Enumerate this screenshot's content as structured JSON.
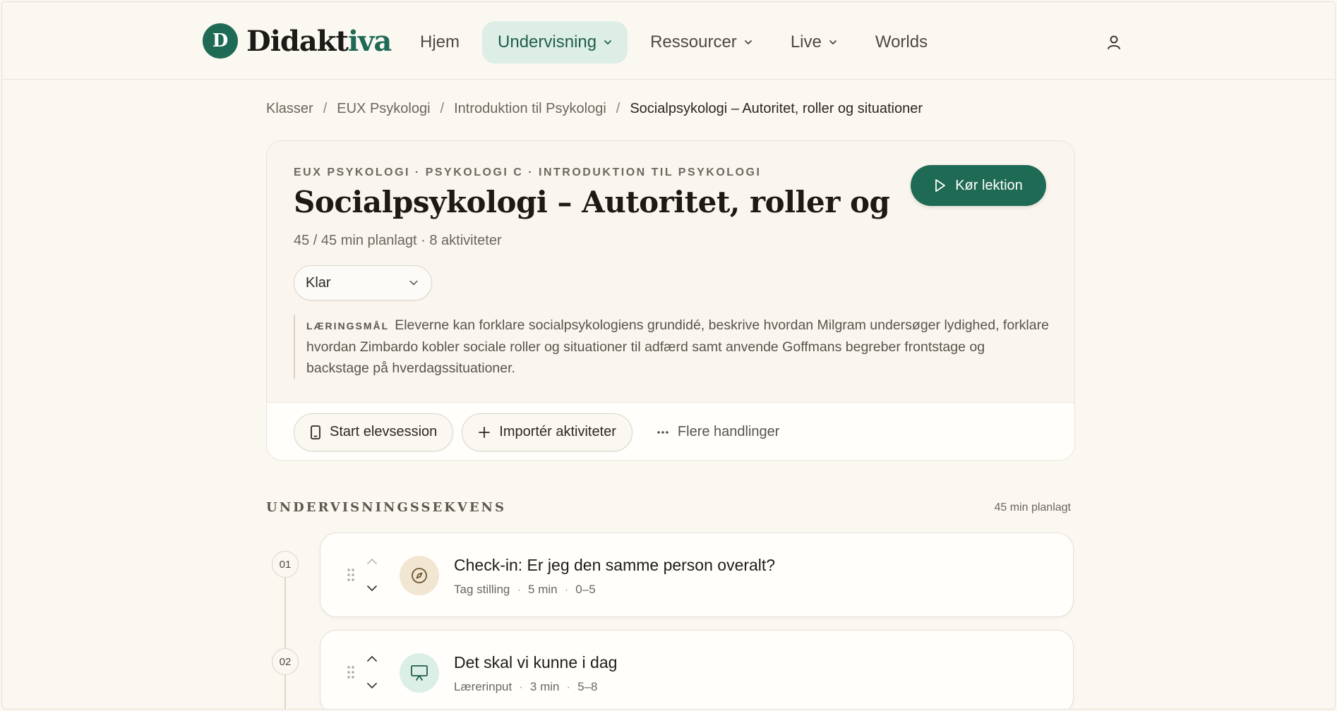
{
  "brand": {
    "letter": "D",
    "name_main": "Didakt",
    "name_accent": "iva",
    "accent_color": "#1f6a55"
  },
  "nav": {
    "items": [
      {
        "label": "Hjem",
        "dropdown": false
      },
      {
        "label": "Undervisning",
        "dropdown": true,
        "active": true
      },
      {
        "label": "Ressourcer",
        "dropdown": true
      },
      {
        "label": "Live",
        "dropdown": true
      },
      {
        "label": "Worlds",
        "dropdown": false
      }
    ],
    "user_icon": "user-icon"
  },
  "breadcrumb": {
    "items": [
      "Klasser",
      "EUX Psykologi",
      "Introduktion til Psykologi"
    ],
    "current": "Socialpsykologi – Autoritet, roller og situationer",
    "separator": "/"
  },
  "lesson": {
    "eyebrow": "EUX PSYKOLOGI · PSYKOLOGI C · INTRODUKTION TIL PSYKOLOGI",
    "title": "Socialpsykologi – Autoritet, roller og situationer",
    "meta": "45 / 45 min planlagt · 8 aktiviteter",
    "run_button": "Kør lektion",
    "status": "Klar",
    "goal_label": "LÆRINGSMÅL",
    "goal_text": "Eleverne kan forklare socialpsykologiens grundidé, beskrive hvordan Milgram undersøger lydighed, forklare hvordan Zimbardo kobler sociale roller og situationer til adfærd samt anvende Goffmans begreber frontstage og backstage på hverdagssituationer.",
    "actions": {
      "start_session": "Start elevsession",
      "import": "Importér aktiviteter",
      "more": "Flere handlinger"
    }
  },
  "sequence": {
    "heading": "UNDERVISNINGSSEKVENS",
    "total": "45 min planlagt",
    "activities": [
      {
        "number": "01",
        "title": "Check-in: Er jeg den samme person overalt?",
        "type": "Tag stilling",
        "duration": "5 min",
        "range": "0–5",
        "icon": "compass-icon",
        "icon_bg": "#f1e6d2",
        "icon_color": "#6e5631"
      },
      {
        "number": "02",
        "title": "Det skal vi kunne i dag",
        "type": "Lærerinput",
        "duration": "3 min",
        "range": "5–8",
        "icon": "presentation-icon",
        "icon_bg": "#dcefe7",
        "icon_color": "#1f5e4b"
      }
    ]
  }
}
